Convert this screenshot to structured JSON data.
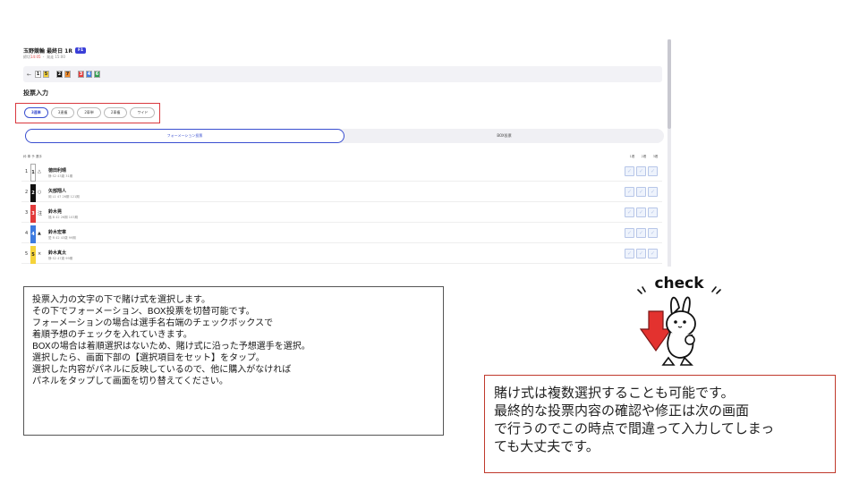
{
  "race": {
    "title": "玉野競輪 最終日 1R",
    "badge": "F1",
    "sub_prefix": "締切",
    "sub_warn": "14:05",
    "sub_suffix": " ・ 発走 15:00"
  },
  "bet_summary": {
    "back": "←",
    "numbers": [
      {
        "label": "1",
        "bg": "#ffffff",
        "fg": "#222222"
      },
      {
        "label": "5",
        "bg": "#f5d33a",
        "fg": "#222222"
      },
      {
        "label": "2",
        "bg": "#111111",
        "fg": "#ffffff"
      },
      {
        "label": "7",
        "bg": "#f08a2a",
        "fg": "#222222"
      },
      {
        "label": "3",
        "bg": "#e23b3b",
        "fg": "#ffffff"
      },
      {
        "label": "4",
        "bg": "#3d7be0",
        "fg": "#ffffff"
      },
      {
        "label": "6",
        "bg": "#2e9b4e",
        "fg": "#ffffff"
      }
    ]
  },
  "section_title": "投票入力",
  "bet_types": [
    {
      "label": "3連単",
      "active": true
    },
    {
      "label": "3連複",
      "active": false
    },
    {
      "label": "2車単",
      "active": false
    },
    {
      "label": "2車複",
      "active": false
    },
    {
      "label": "ワイド",
      "active": false
    }
  ],
  "modes": {
    "formation": "フォーメーション投票",
    "box": "BOX投票"
  },
  "columns": {
    "left": "枠 車 予 選手",
    "right": [
      "1着",
      "2着",
      "3着"
    ]
  },
  "riders": [
    {
      "lane": "1",
      "strip": "1",
      "strip_bg": "#ffffff",
      "strip_fg": "#222222",
      "mark": "△",
      "name": "徳田利晴",
      "detail": "静  S2 43歳 31期"
    },
    {
      "lane": "2",
      "strip": "2",
      "strip_bg": "#111111",
      "strip_fg": "#ffffff",
      "mark": "○",
      "name": "矢部翔人",
      "detail": "岡  L1 47 26期 121期"
    },
    {
      "lane": "3",
      "strip": "3",
      "strip_bg": "#e23b3b",
      "strip_fg": "#ffffff",
      "mark": "注",
      "name": "鈴木晃",
      "detail": "福  B 42 26期 103期"
    },
    {
      "lane": "4",
      "strip": "4",
      "strip_bg": "#3d7be0",
      "strip_fg": "#ffffff",
      "mark": "▲",
      "name": "鈴木宏章",
      "detail": "愛  R 42 43歳 99期"
    },
    {
      "lane": "5",
      "strip": "5",
      "strip_bg": "#f5d33a",
      "strip_fg": "#222222",
      "mark": "×",
      "name": "鈴木真太",
      "detail": "静  S2 47歳 99期"
    }
  ],
  "check_mark": "✓",
  "explanation": [
    "投票入力の文字の下で賭け式を選択します。",
    "その下でフォーメーション、BOX投票を切替可能です。",
    "フォーメーションの場合は選手名右端のチェックボックスで",
    "着順予想のチェックを入れていきます。",
    "BOXの場合は着順選択はないため、賭け式に沿った予想選手を選択。",
    "選択したら、画面下部の【選択項目をセット】をタップ。",
    "選択した内容がパネルに反映しているので、他に購入がなければ",
    "パネルをタップして画面を切り替えてください。"
  ],
  "note": [
    "賭け式は複数選択することも可能です。",
    "最終的な投票内容の確認や修正は次の画面",
    "で行うのでこの時点で間違って入力してしまっ",
    "ても大丈夫です。"
  ],
  "mascot": {
    "label": "check",
    "icon": "rabbit-check-mascot-icon"
  },
  "colors": {
    "accent": "#3a4fd0",
    "highlight": "#d9383e",
    "note_border": "#c0392b"
  }
}
